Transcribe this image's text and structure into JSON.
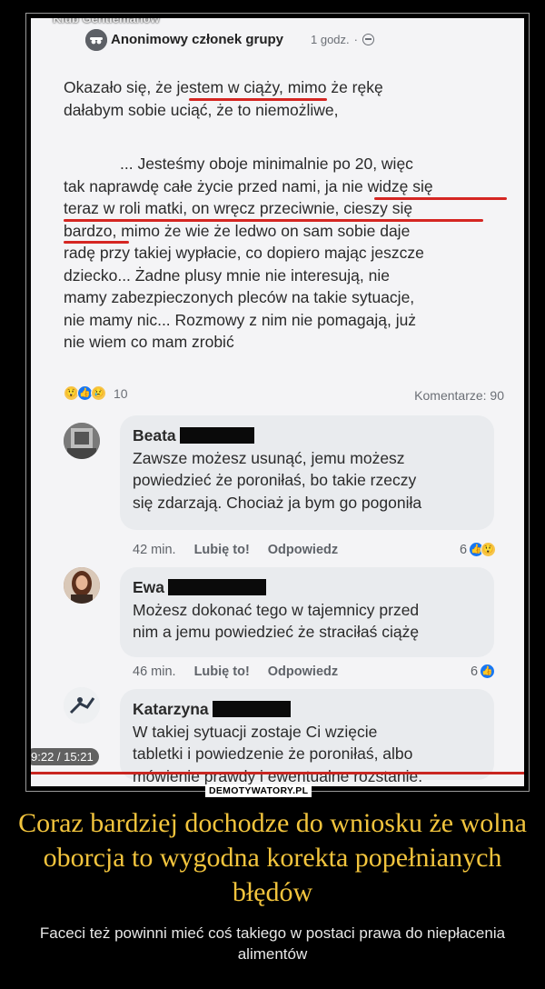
{
  "group": {
    "name": "Klub Gentlemanów"
  },
  "post": {
    "author": "Anonimowy członek grupy",
    "time": "1 godz.",
    "paragraph1": [
      "Okazało się, że jestem w ciąży, mimo że rękę",
      "dałabym sobie uciąć, że to niemożliwe,"
    ],
    "paragraph2": [
      "... Jesteśmy oboje minimalnie po 20, więc",
      "tak naprawdę całe życie przed nami, ja nie widzę się",
      "teraz w roli matki, on wręcz przeciwnie, cieszy się",
      "bardzo, mimo że wie że ledwo on sam sobie daje",
      "radę przy takiej wypłacie, co dopiero mając jeszcze",
      "dziecko... Żadne plusy mnie nie interesują, nie",
      "mamy zabezpieczonych pleców na takie sytuacje,",
      "nie mamy nic... Rozmowy z nim nie pomagają, już",
      "nie wiem co mam zrobić"
    ],
    "reactions_count": "10",
    "comments_label": "Komentarze: 90"
  },
  "comments": [
    {
      "name": "Beata",
      "lines": [
        "Zawsze możesz usunąć, jemu możesz",
        "powiedzieć że poroniłaś, bo takie rzeczy",
        "się zdarzają. Chociaż ja bym go pogoniła"
      ],
      "time": "42 min.",
      "like": "Lubię to!",
      "reply": "Odpowiedz",
      "reactions": "6"
    },
    {
      "name": "Ewa",
      "lines": [
        "Możesz dokonać tego w tajemnicy przed",
        "nim a jemu powiedzieć że straciłaś ciążę"
      ],
      "time": "46 min.",
      "like": "Lubię to!",
      "reply": "Odpowiedz",
      "reactions": "6"
    },
    {
      "name": "Katarzyna",
      "lines": [
        "W takiej sytuacji zostaje Ci wzięcie",
        "tabletki i powiedzenie że poroniłaś, albo",
        "mówienie prawdy i ewentualne rozstanie."
      ]
    }
  ],
  "video": {
    "timestamp": "9:22 / 15:21"
  },
  "watermark": "DEMOTYWATORY.PL",
  "caption": {
    "title": "Coraz bardziej dochodze do wniosku że wolna oborcja to wygodna korekta popełnianych błędów",
    "subtitle": "Faceci też powinni mieć coś takiego w postaci prawa do niepłacenia alimentów"
  },
  "colors": {
    "accent_underline": "#d52622",
    "caption_title": "#f2c43d",
    "like_blue": "#1877f2"
  }
}
